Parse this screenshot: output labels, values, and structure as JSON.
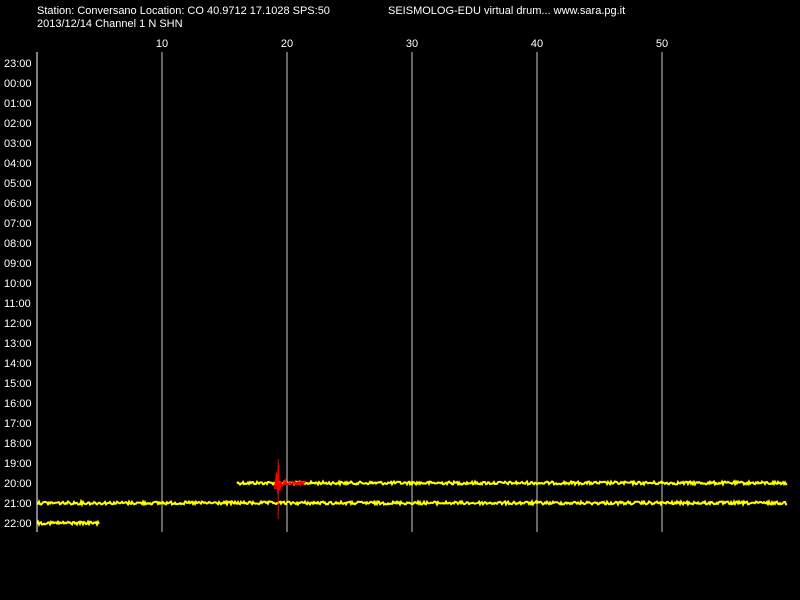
{
  "header": {
    "station_info": "Station: Conversano Location: CO 40.9712 17.1028 SPS:50",
    "date_channel": "2013/12/14  Channel 1 N SHN",
    "app_title": "SEISMOLOG-EDU virtual drum... www.sara.pg.it"
  },
  "colors": {
    "background": "#000000",
    "grid": "#ffffff",
    "trace": "#ffff00",
    "event": "#ff0000",
    "text": "#ffffff"
  },
  "chart_data": {
    "type": "line",
    "title": "",
    "xlabel": "",
    "ylabel": "",
    "x_ticks": [
      "10",
      "20",
      "30",
      "40",
      "50"
    ],
    "x_tick_values": [
      10,
      20,
      30,
      40,
      50
    ],
    "xlim": [
      0,
      60
    ],
    "rows": [
      "23:00",
      "00:00",
      "01:00",
      "02:00",
      "03:00",
      "04:00",
      "05:00",
      "06:00",
      "07:00",
      "08:00",
      "09:00",
      "10:00",
      "11:00",
      "12:00",
      "13:00",
      "14:00",
      "15:00",
      "16:00",
      "17:00",
      "18:00",
      "19:00",
      "20:00",
      "21:00",
      "22:00"
    ],
    "grid": true,
    "series": [
      {
        "row": "20:00",
        "start_min": 16,
        "end_min": 60,
        "color": "trace"
      },
      {
        "row": "21:00",
        "start_min": 0,
        "end_min": 60,
        "color": "trace"
      },
      {
        "row": "22:00",
        "start_min": 0,
        "end_min": 5,
        "color": "trace"
      }
    ],
    "events": [
      {
        "row": "20:00",
        "start_min": 19,
        "end_min": 21.5,
        "peak_min": 19.3,
        "color": "event"
      }
    ]
  }
}
